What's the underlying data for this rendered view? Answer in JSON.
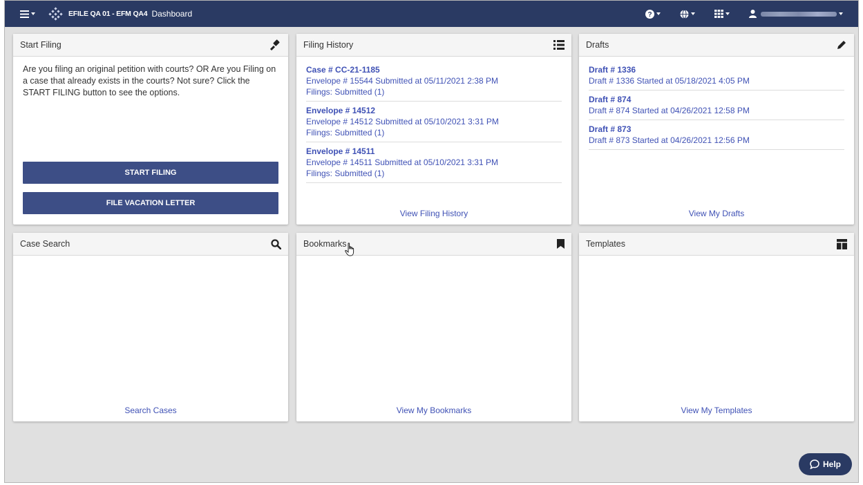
{
  "topbar": {
    "brand": "EFILE QA 01 - EFM QA4",
    "page": "Dashboard",
    "icons": [
      "menu-icon",
      "logo",
      "help-icon",
      "globe-icon",
      "apps-grid-icon",
      "user-icon"
    ],
    "bar_color": "#2a3a63"
  },
  "start_filing": {
    "title": "Start Filing",
    "icon": "gavel-icon",
    "description": "Are you filing an original petition with courts? OR Are you Filing on a case that already exists in the courts? Not sure? Click the START FILING button to see the options.",
    "start_button": "START FILING",
    "vacation_button": "FILE VACATION LETTER"
  },
  "filing_history": {
    "title": "Filing History",
    "icon": "list-icon",
    "items": [
      {
        "title": "Case # CC-21-1185",
        "line1": "Envelope # 15544 Submitted at 05/11/2021 2:38 PM",
        "line2": "Filings: Submitted (1)"
      },
      {
        "title": "Envelope # 14512",
        "line1": "Envelope # 14512 Submitted at 05/10/2021 3:31 PM",
        "line2": "Filings: Submitted (1)"
      },
      {
        "title": "Envelope # 14511",
        "line1": "Envelope # 14511 Submitted at 05/10/2021 3:31 PM",
        "line2": "Filings: Submitted (1)"
      }
    ],
    "footer": "View Filing History"
  },
  "drafts": {
    "title": "Drafts",
    "icon": "pencil-icon",
    "items": [
      {
        "title": "Draft # 1336",
        "line1": "Draft # 1336 Started at 05/18/2021 4:05 PM"
      },
      {
        "title": "Draft # 874",
        "line1": "Draft # 874 Started at 04/26/2021 12:58 PM"
      },
      {
        "title": "Draft # 873",
        "line1": "Draft # 873 Started at 04/26/2021 12:56 PM"
      }
    ],
    "footer": "View My Drafts"
  },
  "case_search": {
    "title": "Case Search",
    "icon": "search-icon",
    "footer": "Search Cases"
  },
  "bookmarks": {
    "title": "Bookmarks",
    "icon": "bookmark-icon",
    "footer": "View My Bookmarks"
  },
  "templates": {
    "title": "Templates",
    "icon": "template-icon",
    "footer": "View My Templates"
  },
  "help": {
    "label": "Help",
    "icon": "chat-icon"
  },
  "colors": {
    "accent": "#3f51b5",
    "button": "#3d4e86",
    "background": "#e0e0e0"
  }
}
